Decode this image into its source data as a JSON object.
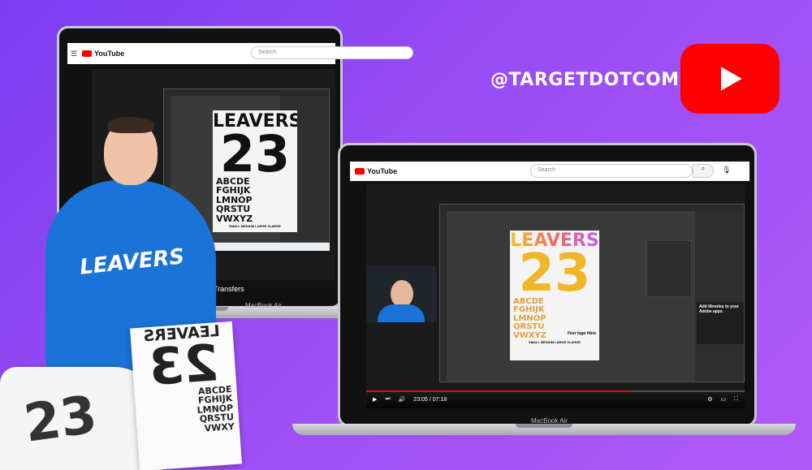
{
  "handle": "@TARGETDOTCOM",
  "youtube": {
    "brand": "YouTube",
    "play_icon": "play-icon",
    "color": "#ff0000"
  },
  "laptop_back": {
    "brand": "YouTube",
    "search_placeholder": "Search",
    "model": "MacBook Air",
    "caption": "Transfers",
    "artwork": {
      "title": "LEAVERS",
      "number": "23",
      "letters": "ABCDE\nFGHIJK\nLMNOP\nQRSTU\nVWXYZ",
      "sizes": "SMALL  MEDIUM  LARGE  XLARGE"
    }
  },
  "laptop_front": {
    "brand": "YouTube",
    "search_placeholder": "Search",
    "model": "MacBook Air",
    "time": "23:05 / 07:18",
    "progress": 0.7,
    "side_panel_title": "Add libraries to your Adobe apps.",
    "artwork": {
      "title": "LEAVERS",
      "number": "23",
      "letters": "ABCDE\nFGHIJK\nLMNOP\nQRSTU\nVWXYZ",
      "sizes": "SMALL  MEDIUM  LARGE  XLARGE",
      "logo_text": "Your logo Here"
    }
  },
  "person": {
    "hoodie_text": "LEAVERS",
    "held_print_title": "LEAVERS",
    "held_print_number": "23",
    "held_letters": "ABCDE\nFGHIJK\nLMNOP\nQRSTU\nVWXY"
  },
  "colors": {
    "background": "#8b45f3",
    "hoodie": "#1a73d6",
    "accent": "#ff0000"
  }
}
